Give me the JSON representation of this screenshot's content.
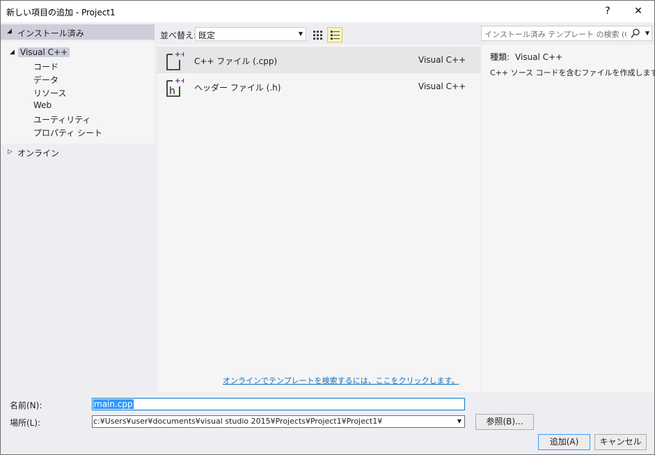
{
  "window": {
    "title": "新しい項目の追加 - Project1",
    "help_label": "?",
    "close_label": "✕"
  },
  "left": {
    "installed_header": "インストール済み",
    "category": "Visual C++",
    "subcategories": [
      "コード",
      "データ",
      "リソース",
      "Web",
      "ユーティリティ",
      "プロパティ シート"
    ],
    "online": "オンライン"
  },
  "toolbar": {
    "sort_label": "並べ替え:",
    "sort_value": "既定"
  },
  "templates": [
    {
      "name": "C++ ファイル (.cpp)",
      "type": "Visual C++",
      "icon": "cpp-file-icon",
      "selected": true
    },
    {
      "name": "ヘッダー ファイル (.h)",
      "type": "Visual C++",
      "icon": "header-file-icon",
      "selected": false
    }
  ],
  "online_link": "オンラインでテンプレートを検索するには、ここをクリックします。",
  "search": {
    "placeholder": "インストール済み テンプレート の検索 (Ctrl+E"
  },
  "details": {
    "kind_label": "種類:",
    "kind_value": "Visual C++",
    "description": "C++ ソース コードを含むファイルを作成します。"
  },
  "form": {
    "name_label": "名前(N):",
    "name_value": "main.cpp",
    "location_label": "場所(L):",
    "location_value": "c:¥Users¥user¥documents¥visual studio 2015¥Projects¥Project1¥Project1¥",
    "browse_label": "参照(B)...",
    "add_label": "追加(A)",
    "cancel_label": "キャンセル"
  },
  "colors": {
    "accent": "#007acc",
    "link": "#0e70c0",
    "selection": "#3399ff",
    "cpp_plus": "#68217a"
  }
}
